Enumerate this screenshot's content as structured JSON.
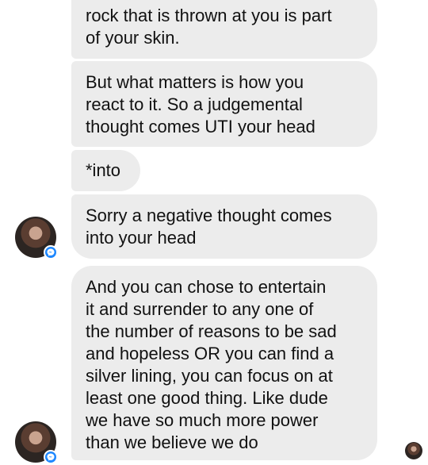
{
  "messages": [
    {
      "text": "rock that is thrown at you is part\nof your skin."
    },
    {
      "text": "But what matters is how you\nreact to it. So a judgemental\nthought comes UTI your head"
    },
    {
      "text": "*into"
    },
    {
      "text": "Sorry a negative thought comes\ninto your head"
    },
    {
      "text": "And you can chose to entertain\nit and surrender to any one of\nthe number of reasons to be sad\nand hopeless OR you can find a\nsilver lining, you can focus on at\nleast one good thing. Like dude\nwe have so much more power\nthan we believe we do"
    }
  ],
  "colors": {
    "bubble": "#ececec",
    "messenger_badge": "#1e88ff",
    "background": "#ffffff"
  },
  "icons": {
    "avatar_badge": "messenger-icon"
  }
}
